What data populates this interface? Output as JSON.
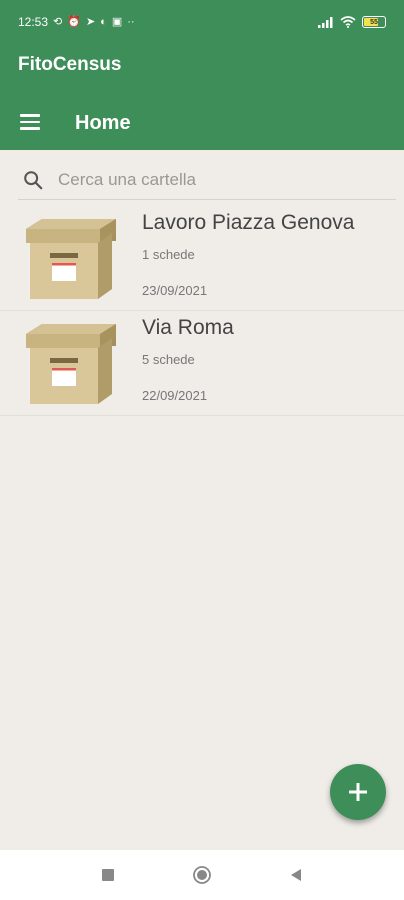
{
  "status_bar": {
    "time": "12:53",
    "extra": "··",
    "battery_level": "55"
  },
  "app_bar": {
    "app_title": "FitoCensus",
    "page_title": "Home"
  },
  "search": {
    "placeholder": "Cerca una cartella"
  },
  "folders": [
    {
      "name": "Lavoro Piazza Genova",
      "count": "1 schede",
      "date": "23/09/2021"
    },
    {
      "name": "Via Roma",
      "count": "5 schede",
      "date": "22/09/2021"
    }
  ],
  "colors": {
    "primary": "#3e8e5a",
    "background": "#f0ede8"
  },
  "icons": {
    "menu": "hamburger-menu-icon",
    "search": "search-icon",
    "folder": "archive-box-icon",
    "fab": "plus-icon",
    "nav_recents": "square-icon",
    "nav_home": "circle-icon",
    "nav_back": "triangle-back-icon"
  }
}
